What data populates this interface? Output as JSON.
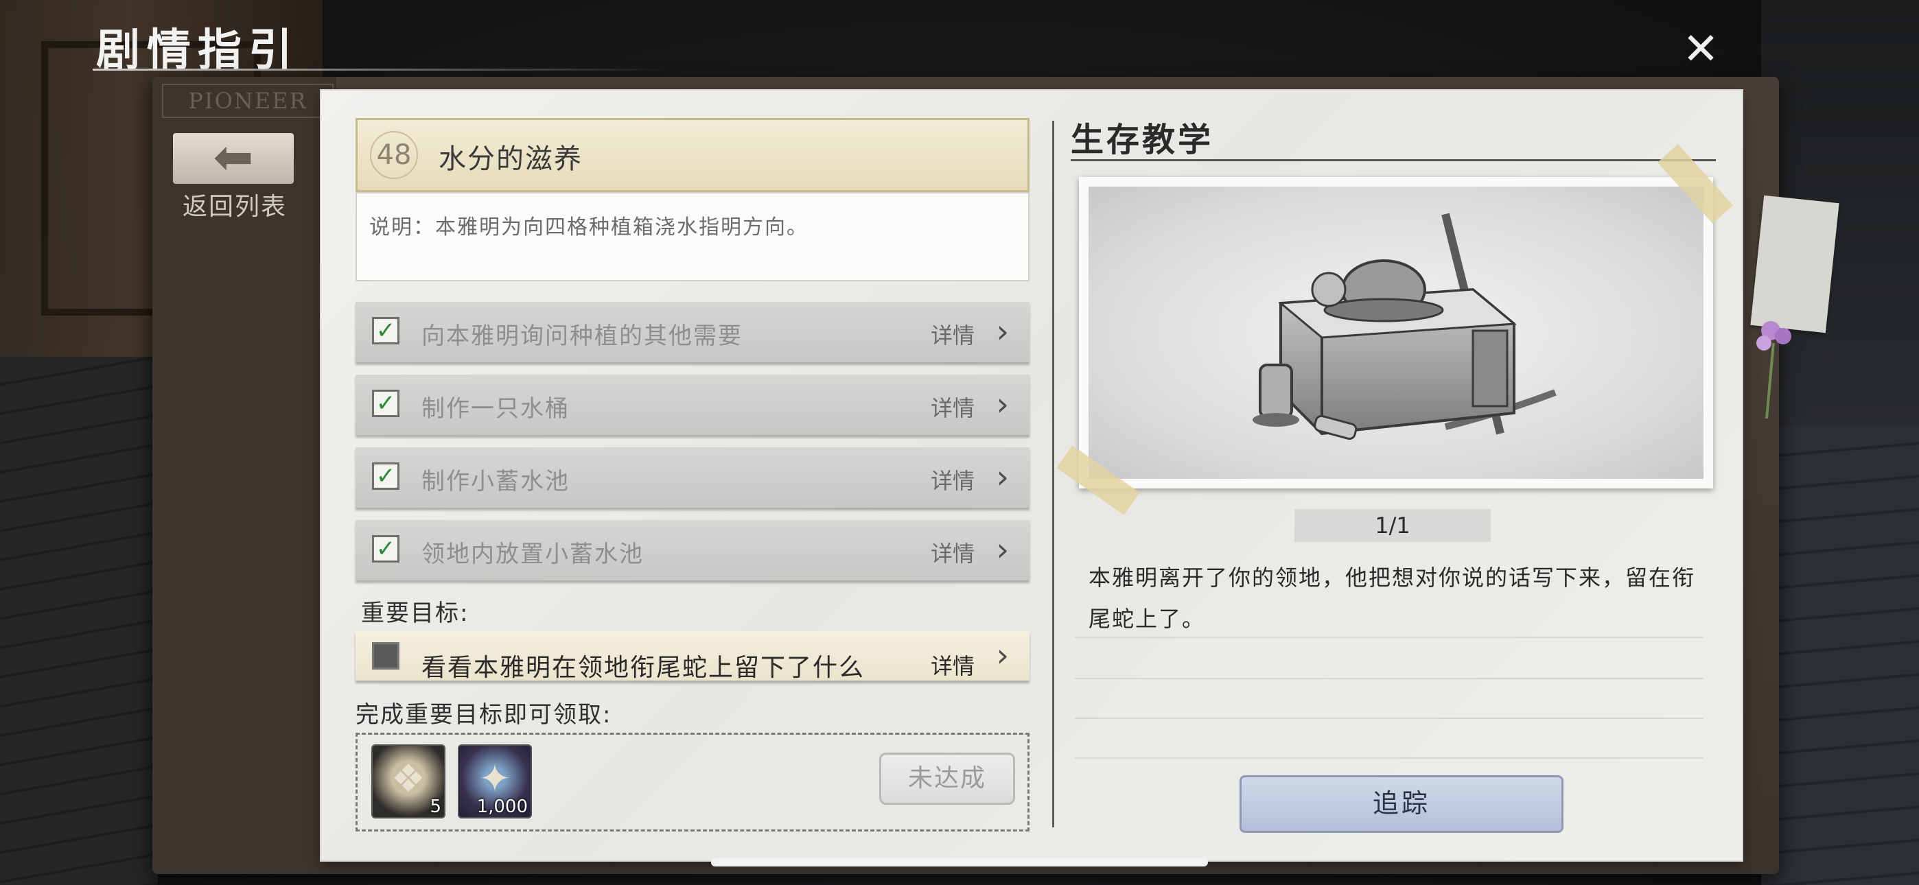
{
  "header": {
    "title": "剧情指引",
    "close_icon": "close-x-icon"
  },
  "sidebar": {
    "brand": "PIONEER",
    "back_icon": "arrow-left-icon",
    "back_label": "返回列表"
  },
  "quest": {
    "number": "48",
    "name": "水分的滋养",
    "description": "说明：本雅明为向四格种植箱浇水指明方向。",
    "tasks": [
      {
        "label": "向本雅明询问种植的其他需要",
        "detail": "详情",
        "done": true
      },
      {
        "label": "制作一只水桶",
        "detail": "详情",
        "done": true
      },
      {
        "label": "制作小蓄水池",
        "detail": "详情",
        "done": true
      },
      {
        "label": "领地内放置小蓄水池",
        "detail": "详情",
        "done": true
      }
    ],
    "key_objective_label": "重要目标:",
    "key_objective": {
      "label": "看看本雅明在领地衔尾蛇上留下了什么",
      "detail": "详情",
      "done": false
    },
    "reward_label": "完成重要目标即可领取:",
    "rewards": [
      {
        "icon": "seed-bag-icon",
        "qty": "5"
      },
      {
        "icon": "experience-icon",
        "qty": "1,000"
      }
    ],
    "claim_button": "未达成"
  },
  "tutorial": {
    "title": "生存教学",
    "image_alt_icon": "supply-crate-icon",
    "page": "1/1",
    "text": "本雅明离开了你的领地，他把想对你说的话写下来，留在衔尾蛇上了。",
    "track_button": "追踪"
  },
  "colors": {
    "completed_check": "#2f8a3a",
    "quest_header_bg": "#f3ecd5",
    "track_button_bg": "#cfd9ea"
  }
}
